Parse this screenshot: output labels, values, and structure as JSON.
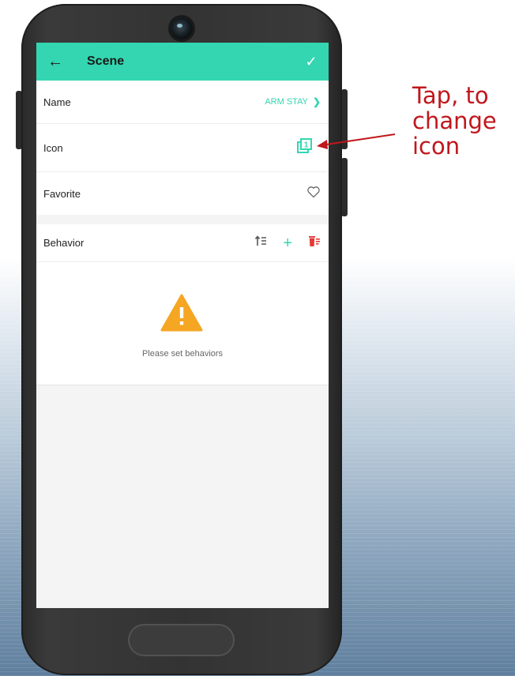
{
  "appbar": {
    "title": "Scene",
    "back_icon": "arrow-left-icon",
    "confirm_icon": "check-icon"
  },
  "rows": {
    "name": {
      "label": "Name",
      "value": "ARM STAY"
    },
    "icon": {
      "label": "Icon",
      "value_icon": "scene-icon-1"
    },
    "favorite": {
      "label": "Favorite",
      "value_icon": "heart-outline-icon"
    },
    "behavior": {
      "label": "Behavior",
      "actions": [
        "sort-icon",
        "add-icon",
        "delete-list-icon"
      ]
    }
  },
  "empty_state": {
    "icon": "warning-icon",
    "message": "Please set behaviors"
  },
  "annotation": {
    "text": "Tap, to\nchange\nicon"
  },
  "colors": {
    "accent": "#33d6b0",
    "warning": "#f5a623",
    "delete": "#e53935",
    "annotation": "#c0171c"
  }
}
